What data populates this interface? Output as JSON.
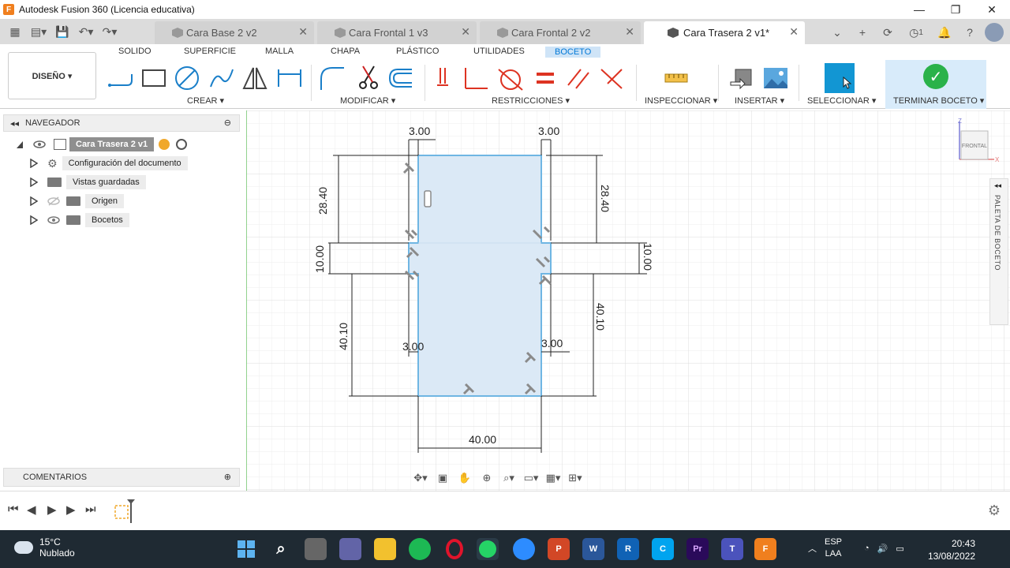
{
  "window": {
    "title": "Autodesk Fusion 360 (Licencia educativa)"
  },
  "tabs": [
    {
      "label": "Cara Base 2 v2",
      "active": false
    },
    {
      "label": "Cara Frontal 1 v3",
      "active": false
    },
    {
      "label": "Cara Frontal 2 v2",
      "active": false
    },
    {
      "label": "Cara Trasera 2 v1*",
      "active": true
    }
  ],
  "notification_count": "1",
  "ribbon": {
    "workspace": "DISEÑO ▾",
    "tabs": [
      "SOLIDO",
      "SUPERFICIE",
      "MALLA",
      "CHAPA",
      "PLÁSTICO",
      "UTILIDADES",
      "BOCETO"
    ],
    "active_tab": "BOCETO",
    "groups": {
      "create": "CREAR ▾",
      "modify": "MODIFICAR ▾",
      "constraints": "RESTRICCIONES ▾",
      "inspect": "INSPECCIONAR ▾",
      "insert": "INSERTAR ▾",
      "select": "SELECCIONAR ▾",
      "finish": "TERMINAR BOCETO ▾"
    }
  },
  "browser": {
    "header": "NAVEGADOR",
    "root": "Cara Trasera 2 v1",
    "items": [
      {
        "label": "Configuración del documento"
      },
      {
        "label": "Vistas guardadas"
      },
      {
        "label": "Origen"
      },
      {
        "label": "Bocetos"
      }
    ]
  },
  "comments": {
    "header": "COMENTARIOS"
  },
  "viewcube": {
    "face": "FRONTAL",
    "axis_z": "Z",
    "axis_x": "X"
  },
  "sketch_palette": {
    "label": "PALETA DE BOCETO"
  },
  "sketch": {
    "dimensions": {
      "top_left_width": "3.00",
      "top_right_width": "3.00",
      "left_top_height": "28.40",
      "right_top_height": "28.40",
      "left_mid_height": "10.00",
      "right_mid_height": "10.00",
      "left_bottom_height": "40.10",
      "right_bottom_height": "40.10",
      "bottom_left_width": "3.00",
      "bottom_right_width": "3.00",
      "total_width": "40.00"
    }
  },
  "taskbar": {
    "weather_temp": "15°C",
    "weather_desc": "Nublado",
    "lang_top": "ESP",
    "lang_bottom": "LAA",
    "time": "20:43",
    "date": "13/08/2022"
  },
  "colors": {
    "accent": "#0078d7",
    "sketch_fill": "#dbe9f6",
    "sketch_line": "#6fb6e3",
    "select": "#1296d3",
    "finish": "#2ab24a"
  }
}
